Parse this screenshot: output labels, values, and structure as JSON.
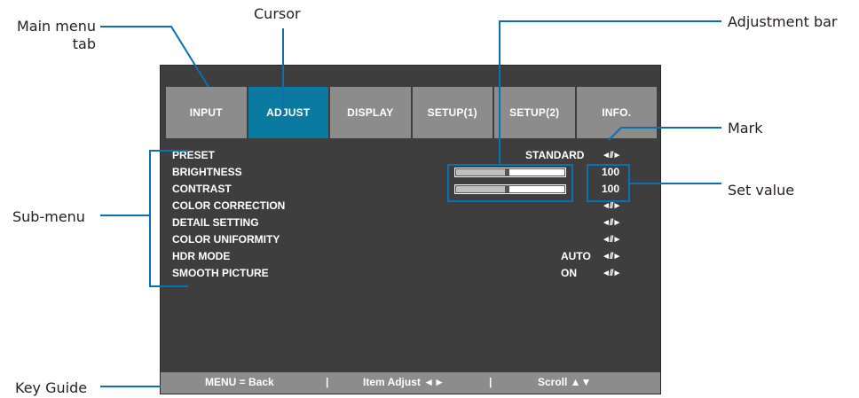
{
  "callouts": {
    "main_menu_tab": [
      "Main menu",
      "tab"
    ],
    "cursor": "Cursor",
    "adjustment_bar": "Adjustment bar",
    "mark": "Mark",
    "set_value": "Set value",
    "sub_menu": "Sub-menu",
    "key_guide": "Key Guide"
  },
  "tabs": [
    {
      "label": "INPUT",
      "active": false
    },
    {
      "label": "ADJUST",
      "active": true
    },
    {
      "label": "DISPLAY",
      "active": false
    },
    {
      "label": "SETUP(1)",
      "active": false
    },
    {
      "label": "SETUP(2)",
      "active": false
    },
    {
      "label": "INFO.",
      "active": false
    }
  ],
  "items": [
    {
      "label": "PRESET",
      "value": "STANDARD",
      "mark": "◄//►"
    },
    {
      "label": "BRIGHTNESS",
      "level": 0.5,
      "set_value": "100"
    },
    {
      "label": "CONTRAST",
      "level": 0.5,
      "set_value": "100"
    },
    {
      "label": "COLOR CORRECTION",
      "mark": "◄//►"
    },
    {
      "label": "DETAIL SETTING",
      "mark": "◄//►"
    },
    {
      "label": "COLOR UNIFORMITY",
      "mark": "◄//►"
    },
    {
      "label": "HDR MODE",
      "value": "AUTO",
      "mark": "◄//►"
    },
    {
      "label": "SMOOTH PICTURE",
      "value": "ON",
      "mark": "◄//►"
    }
  ],
  "key_guide": {
    "back": "MENU  =  Back",
    "sep1": "|",
    "adjust": "Item  Adjust  ◄►",
    "sep2": "|",
    "scroll": "Scroll    ▲▼"
  },
  "colors": {
    "accent": "#0a70b3",
    "active_tab": "#0a7aa0",
    "osd_background": "#3e3e3e",
    "tab_background": "#8c8c8c"
  }
}
